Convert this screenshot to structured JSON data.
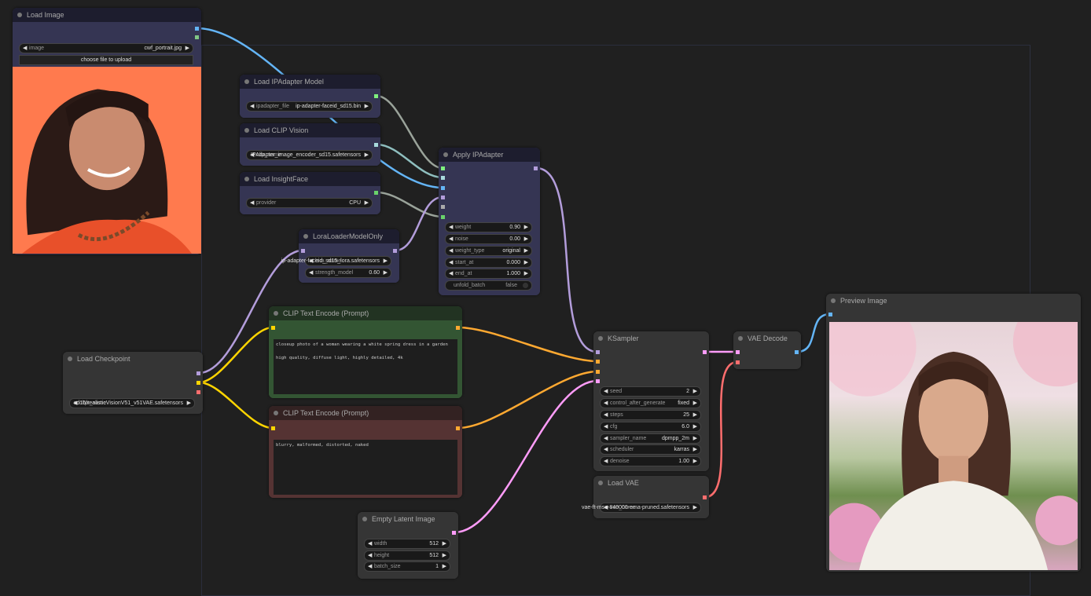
{
  "colors": {
    "canvas_bg": "#202020",
    "node_default_title": "#353535",
    "node_default_body": "#353535",
    "node_blue_title": "#1d1d2e",
    "node_blue_body": "#353553",
    "node_green_title": "#223322",
    "node_green_body": "#335533",
    "node_red_title": "#332222",
    "node_red_body": "#553333",
    "slot_model": "#b39ddb",
    "slot_clip": "#ffd500",
    "slot_vae": "#ff6e6e",
    "slot_conditioning": "#ffa931",
    "slot_latent": "#ff9cf9",
    "slot_image": "#64b5f6",
    "slot_mask": "#81c784",
    "slot_ipadapter": "#7ef07e",
    "slot_clip_vision": "#a8dadc",
    "slot_insightface": "#69d36b",
    "wire_ipadapter": "#9aa39a",
    "wire_clip_vision": "#8fbfbf"
  },
  "nodes": [
    {
      "id": "load_image",
      "title": "Load Image",
      "theme": "blue",
      "widgets": [
        {
          "type": "combo",
          "label": "image",
          "value": "cwf_portrait.jpg"
        },
        {
          "type": "button",
          "label": "choose file to upload"
        }
      ],
      "outputs": [
        "image",
        "mask"
      ],
      "preview": "portrait of a woman with dark wavy hair and bangs laughing against an orange background"
    },
    {
      "id": "ipadapter_model",
      "title": "Load IPAdapter Model",
      "theme": "blue",
      "widgets": [
        {
          "type": "combo",
          "label": "ipadapter_file",
          "value": "ip-adapter-faceid_sd15.bin"
        }
      ],
      "outputs": [
        "ipadapter"
      ]
    },
    {
      "id": "clip_vision",
      "title": "Load CLIP Vision",
      "theme": "blue",
      "widgets": [
        {
          "type": "combo",
          "label": "clip_name",
          "value": "IPAdapter_image_encoder_sd15.safetensors"
        }
      ],
      "outputs": [
        "clip_vision"
      ]
    },
    {
      "id": "insightface",
      "title": "Load InsightFace",
      "theme": "blue",
      "widgets": [
        {
          "type": "combo",
          "label": "provider",
          "value": "CPU"
        }
      ],
      "outputs": [
        "insightface"
      ]
    },
    {
      "id": "lora",
      "title": "LoraLoaderModelOnly",
      "theme": "blue",
      "widgets": [
        {
          "type": "combo",
          "label": "lora_name",
          "value": "ip-adapter-faceid_sd15_lora.safetensors"
        },
        {
          "type": "number",
          "label": "strength_model",
          "value": "0.60"
        }
      ],
      "inputs": [
        "model"
      ],
      "outputs": [
        "model"
      ]
    },
    {
      "id": "apply_ipadapter",
      "title": "Apply IPAdapter",
      "theme": "blue",
      "widgets": [
        {
          "type": "number",
          "label": "weight",
          "value": "0.90"
        },
        {
          "type": "number",
          "label": "noise",
          "value": "0.00"
        },
        {
          "type": "combo",
          "label": "weight_type",
          "value": "original"
        },
        {
          "type": "number",
          "label": "start_at",
          "value": "0.000"
        },
        {
          "type": "number",
          "label": "end_at",
          "value": "1.000"
        },
        {
          "type": "toggle",
          "label": "unfold_batch",
          "value": "false"
        }
      ],
      "inputs": [
        "ipadapter",
        "clip_vision",
        "image",
        "model",
        "attn_mask",
        "insightface"
      ],
      "outputs": [
        "model"
      ]
    },
    {
      "id": "checkpoint",
      "title": "Load Checkpoint",
      "theme": "default",
      "widgets": [
        {
          "type": "combo",
          "label": "ckpt_name",
          "value": "sd15/realisticVisionV51_v51VAE.safetensors"
        }
      ],
      "outputs": [
        "model",
        "clip",
        "vae"
      ]
    },
    {
      "id": "clip_pos",
      "title": "CLIP Text Encode (Prompt)",
      "theme": "green",
      "text": "closeup photo of a woman wearing a white spring dress in a garden\n\nhigh quality, diffuse light, highly detailed, 4k",
      "inputs": [
        "clip"
      ],
      "outputs": [
        "conditioning"
      ]
    },
    {
      "id": "clip_neg",
      "title": "CLIP Text Encode (Prompt)",
      "theme": "red",
      "text": "blurry, malformed, distorted, naked",
      "inputs": [
        "clip"
      ],
      "outputs": [
        "conditioning"
      ]
    },
    {
      "id": "latent",
      "title": "Empty Latent Image",
      "theme": "default",
      "widgets": [
        {
          "type": "number",
          "label": "width",
          "value": "512"
        },
        {
          "type": "number",
          "label": "height",
          "value": "512"
        },
        {
          "type": "number",
          "label": "batch_size",
          "value": "1"
        }
      ],
      "outputs": [
        "latent"
      ]
    },
    {
      "id": "ksampler",
      "title": "KSampler",
      "theme": "default",
      "widgets": [
        {
          "type": "number",
          "label": "seed",
          "value": "2"
        },
        {
          "type": "combo",
          "label": "control_after_generate",
          "value": "fixed"
        },
        {
          "type": "number",
          "label": "steps",
          "value": "25"
        },
        {
          "type": "number",
          "label": "cfg",
          "value": "6.0"
        },
        {
          "type": "combo",
          "label": "sampler_name",
          "value": "dpmpp_2m"
        },
        {
          "type": "combo",
          "label": "scheduler",
          "value": "karras"
        },
        {
          "type": "number",
          "label": "denoise",
          "value": "1.00"
        }
      ],
      "inputs": [
        "model",
        "conditioning",
        "conditioning",
        "latent"
      ],
      "outputs": [
        "latent"
      ]
    },
    {
      "id": "load_vae",
      "title": "Load VAE",
      "theme": "default",
      "widgets": [
        {
          "type": "combo",
          "label": "vae_name",
          "value": "vae-ft-mse-840000-ema-pruned.safetensors"
        }
      ],
      "outputs": [
        "vae"
      ]
    },
    {
      "id": "vae_decode",
      "title": "VAE Decode",
      "theme": "default",
      "inputs": [
        "latent",
        "vae"
      ],
      "outputs": [
        "image"
      ]
    },
    {
      "id": "preview",
      "title": "Preview Image",
      "theme": "default",
      "inputs": [
        "image"
      ],
      "preview": "generated portrait of a woman with bangs in a white spring dress in a blossoming garden"
    }
  ],
  "links": [
    {
      "from": "load_image.0",
      "to": "apply_ipadapter.2",
      "type": "image"
    },
    {
      "from": "ipadapter_model.0",
      "to": "apply_ipadapter.0",
      "type": "ipadapter"
    },
    {
      "from": "clip_vision.0",
      "to": "apply_ipadapter.1",
      "type": "clip_vision"
    },
    {
      "from": "insightface.0",
      "to": "apply_ipadapter.5",
      "type": "ipadapter"
    },
    {
      "from": "lora.0",
      "to": "apply_ipadapter.3",
      "type": "model"
    },
    {
      "from": "checkpoint.0",
      "to": "lora.0",
      "type": "model"
    },
    {
      "from": "checkpoint.1",
      "to": "clip_pos.0",
      "type": "clip"
    },
    {
      "from": "checkpoint.1",
      "to": "clip_neg.0",
      "type": "clip"
    },
    {
      "from": "apply_ipadapter.0",
      "to": "ksampler.0",
      "type": "model"
    },
    {
      "from": "clip_pos.0",
      "to": "ksampler.1",
      "type": "conditioning"
    },
    {
      "from": "clip_neg.0",
      "to": "ksampler.2",
      "type": "conditioning"
    },
    {
      "from": "latent.0",
      "to": "ksampler.3",
      "type": "latent"
    },
    {
      "from": "ksampler.0",
      "to": "vae_decode.0",
      "type": "latent"
    },
    {
      "from": "load_vae.0",
      "to": "vae_decode.1",
      "type": "vae"
    },
    {
      "from": "vae_decode.0",
      "to": "preview.0",
      "type": "image"
    }
  ]
}
